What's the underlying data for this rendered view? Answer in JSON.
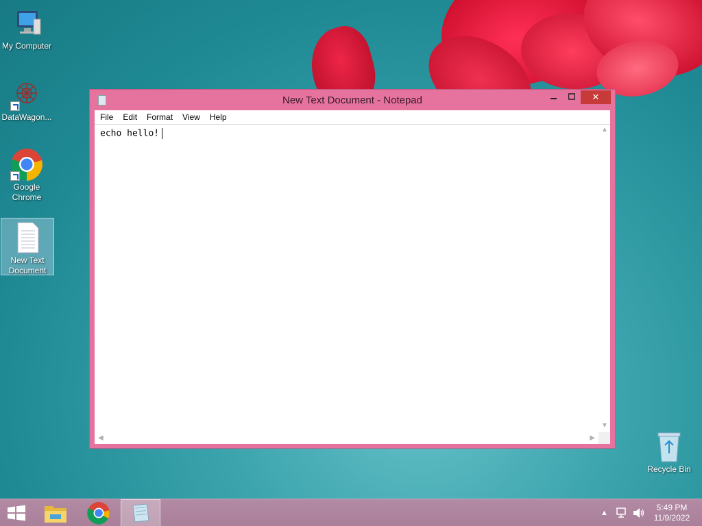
{
  "desktop": {
    "icons": [
      {
        "label": "My Computer"
      },
      {
        "label": "DataWagon..."
      },
      {
        "label": "Google Chrome"
      },
      {
        "label": "New Text Document"
      }
    ],
    "recycle_bin": {
      "label": "Recycle Bin"
    }
  },
  "window": {
    "title": "New Text Document - Notepad",
    "minimize_icon": "minimize-icon",
    "maximize_icon": "maximize-icon",
    "close_symbol": "✕",
    "frame_color": "#e6739e",
    "menu": [
      "File",
      "Edit",
      "Format",
      "View",
      "Help"
    ],
    "content": "echo hello!"
  },
  "taskbar": {
    "items": [
      "start-icon",
      "file-explorer-icon",
      "chrome-icon",
      "notepad-icon"
    ],
    "tray": {
      "time": "5:49 PM",
      "date": "11/9/2022"
    }
  },
  "colors": {
    "taskbar": "#a97f99",
    "close_button": "#c73a3a",
    "desktop": "#1f8a94"
  }
}
